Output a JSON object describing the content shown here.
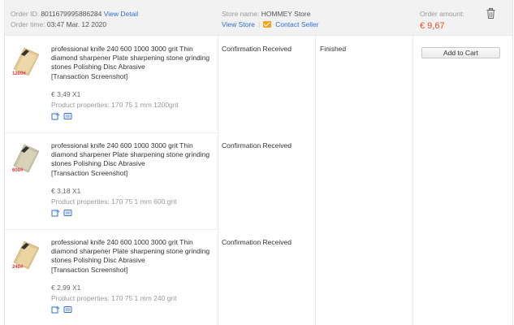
{
  "order": {
    "id_label": "Order ID:",
    "id_value": "8011679995886284",
    "view_detail": "View Detail",
    "time_label": "Order time:",
    "time_value": "03:47 Mar. 12 2020",
    "store_label": "Store name:",
    "store_value": "HOMMEY Store",
    "view_store": "View Store",
    "contact_seller": "Contact Seller",
    "amount_label": "Order amount:",
    "amount_value": "€ 9,67",
    "status": "Finished",
    "add_to_cart": "Add to Cart"
  },
  "items": [
    {
      "title": "professional knife 240 600 1000 3000 grit Thin diamond sharpener Plate sharpening stone grinding stones Polishing Disc Abrasive",
      "screenshot_link": "[Transaction Screenshot]",
      "price": "€ 3,49 X1",
      "properties": "Product properties: 170 75 1 mm 1200grit",
      "status": "Confirmation Received",
      "thumb_text": "1200#"
    },
    {
      "title": "professional knife 240 600 1000 3000 grit Thin diamond sharpener Plate sharpening stone grinding stones Polishing Disc Abrasive",
      "screenshot_link": "[Transaction Screenshot]",
      "price": "€ 3,18 X1",
      "properties": "Product properties: 170 75 1 mm 600 grit",
      "status": "Confirmation Received",
      "thumb_text": "600#"
    },
    {
      "title": "professional knife 240 600 1000 3000 grit Thin diamond sharpener Plate sharpening stone grinding stones Polishing Disc Abrasive",
      "screenshot_link": "[Transaction Screenshot]",
      "price": "€ 2,99 X1",
      "properties": "Product properties: 170 75 1 mm 240 grit",
      "status": "Confirmation Received",
      "thumb_text": "240#"
    }
  ],
  "icons": {
    "trash": "trash-icon",
    "mail": "mail-icon",
    "snapshot": "snapshot-icon",
    "coupon": "coupon-icon"
  },
  "colors": {
    "link": "#2e6fd6",
    "amount": "#e94e1c",
    "contact_icon": "#f7a21b",
    "header_bg": "#f2f2f2"
  }
}
